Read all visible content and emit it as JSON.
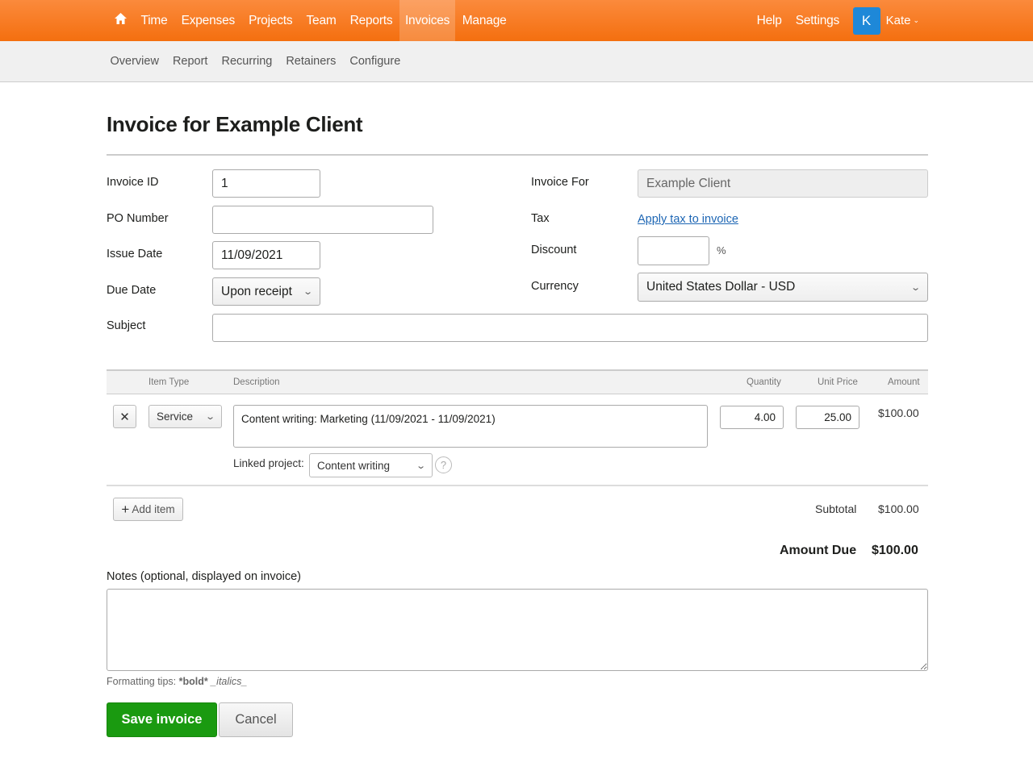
{
  "topnav": {
    "home_icon": "home-icon",
    "items": [
      "Time",
      "Expenses",
      "Projects",
      "Team",
      "Reports",
      "Invoices",
      "Manage"
    ],
    "active": "Invoices",
    "right": {
      "help": "Help",
      "settings": "Settings",
      "avatar_initial": "K",
      "user_name": "Kate"
    },
    "brand_color": "#f47a20"
  },
  "subnav": {
    "items": [
      "Overview",
      "Report",
      "Recurring",
      "Retainers",
      "Configure"
    ]
  },
  "page": {
    "title": "Invoice for Example Client"
  },
  "form": {
    "invoice_id": {
      "label": "Invoice ID",
      "value": "1"
    },
    "po_number": {
      "label": "PO Number",
      "value": ""
    },
    "issue_date": {
      "label": "Issue Date",
      "value": "11/09/2021"
    },
    "due_date": {
      "label": "Due Date",
      "value": "Upon receipt"
    },
    "subject": {
      "label": "Subject",
      "value": ""
    },
    "invoice_for": {
      "label": "Invoice For",
      "value": "Example Client"
    },
    "tax": {
      "label": "Tax",
      "link": "Apply tax to invoice"
    },
    "discount": {
      "label": "Discount",
      "value": "",
      "unit": "%"
    },
    "currency": {
      "label": "Currency",
      "value": "United States Dollar - USD"
    }
  },
  "items": {
    "headers": {
      "item_type": "Item Type",
      "description": "Description",
      "quantity": "Quantity",
      "unit_price": "Unit Price",
      "amount": "Amount"
    },
    "rows": [
      {
        "item_type": "Service",
        "description": "Content writing: Marketing (11/09/2021 - 11/09/2021)",
        "quantity": "4.00",
        "unit_price": "25.00",
        "amount": "$100.00",
        "linked_project_label": "Linked project:",
        "linked_project": "Content writing"
      }
    ],
    "add_item": "Add item"
  },
  "totals": {
    "subtotal_label": "Subtotal",
    "subtotal": "$100.00",
    "amount_due_label": "Amount Due",
    "amount_due": "$100.00"
  },
  "notes": {
    "label": "Notes (optional, displayed on invoice)",
    "value": "",
    "tips_prefix": "Formatting tips: ",
    "tips_bold": "*bold*",
    "tips_italic": "_italics_"
  },
  "actions": {
    "save": "Save invoice",
    "cancel": "Cancel",
    "save_color": "#1a9a10"
  }
}
